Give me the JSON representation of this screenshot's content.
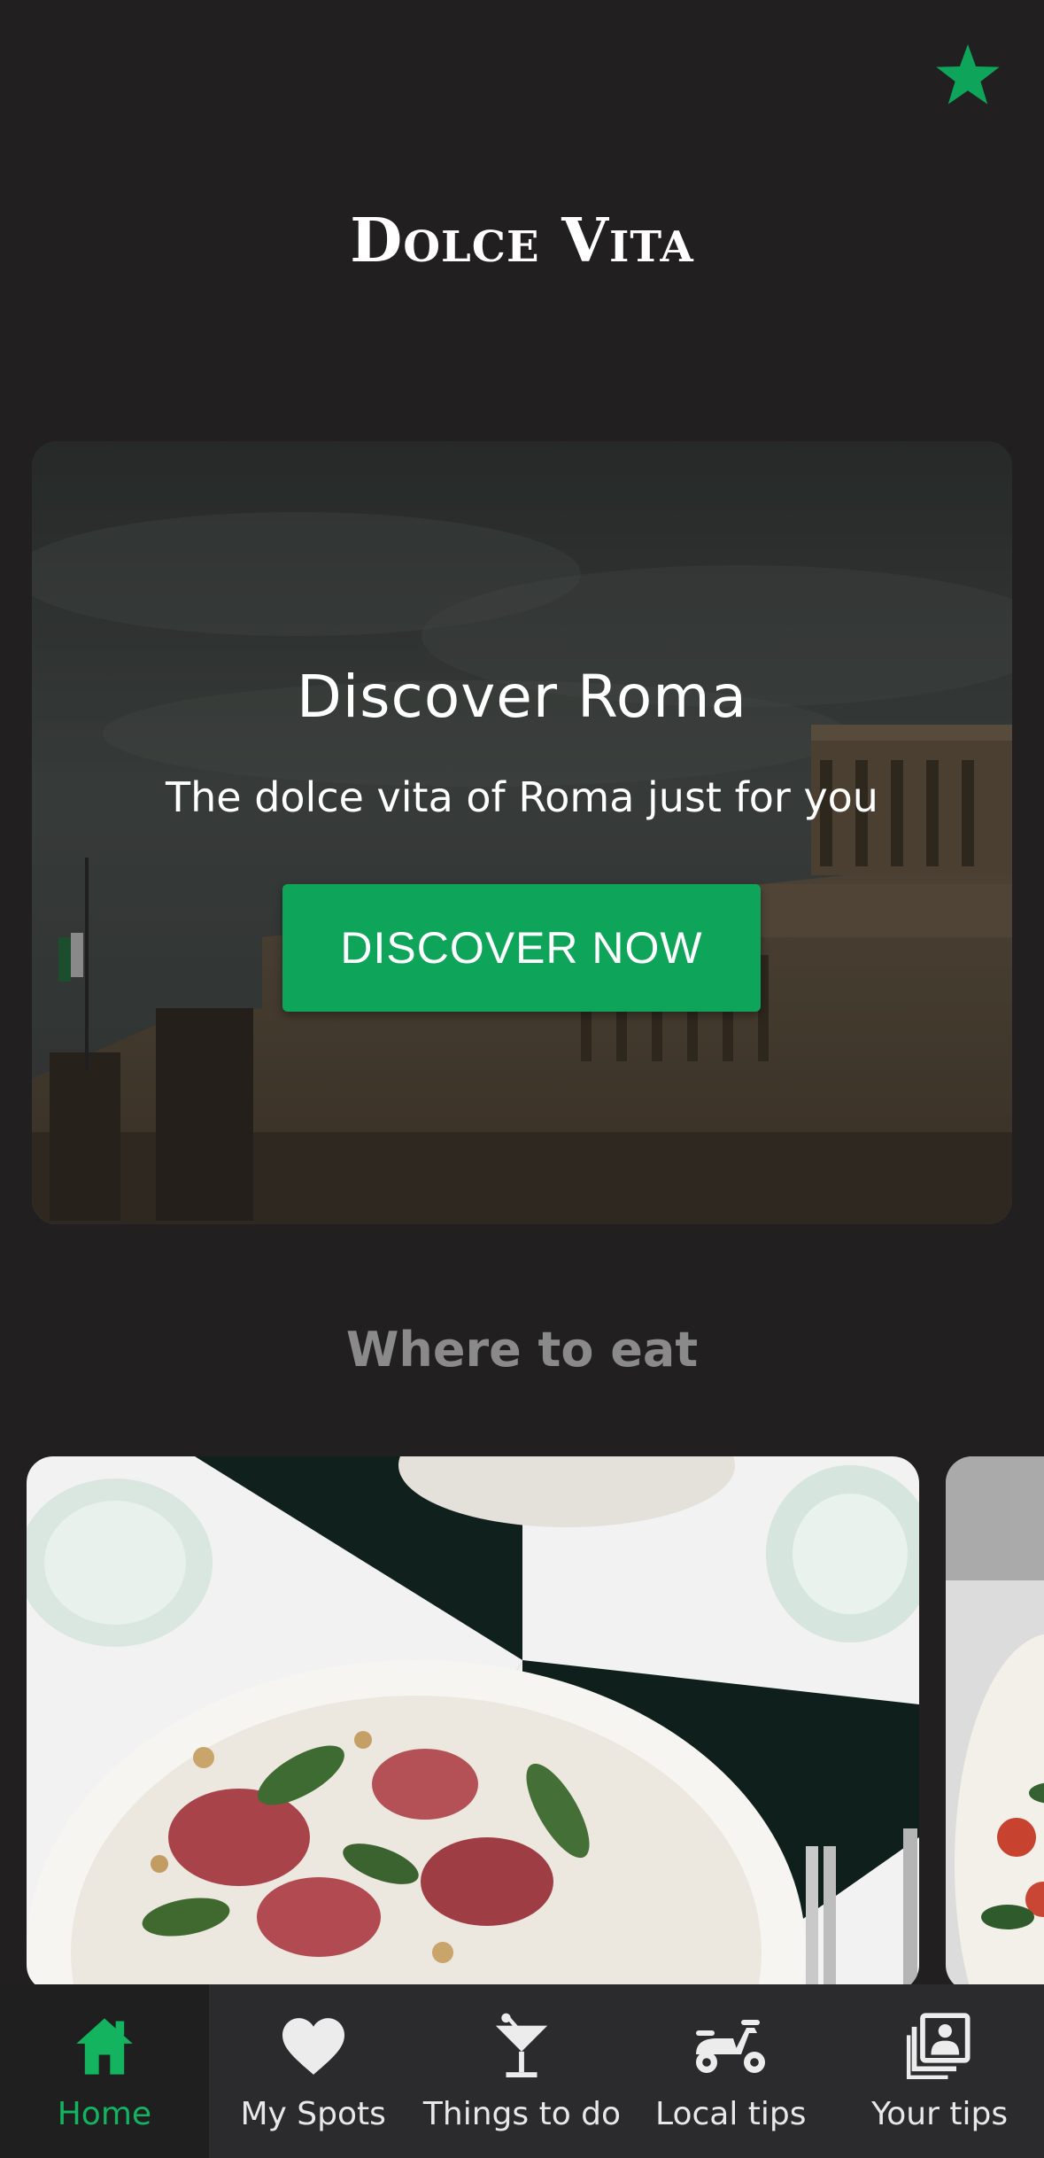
{
  "app": {
    "title": "Dolce Vita"
  },
  "colors": {
    "accent": "#0ea55a",
    "background": "#211f20",
    "tabbar": "#2b2b2d",
    "section_title": "#8a8a8a"
  },
  "hero": {
    "title": "Discover Roma",
    "subtitle": "The dolce vita of Roma just for you",
    "cta_label": "DISCOVER NOW"
  },
  "sections": {
    "eat_title": "Where to eat"
  },
  "tabs": [
    {
      "label": "Home",
      "icon": "home-icon",
      "active": true
    },
    {
      "label": "My Spots",
      "icon": "heart-icon",
      "active": false
    },
    {
      "label": "Things to do",
      "icon": "cocktail-icon",
      "active": false
    },
    {
      "label": "Local tips",
      "icon": "scooter-icon",
      "active": false
    },
    {
      "label": "Your tips",
      "icon": "photos-icon",
      "active": false
    }
  ]
}
